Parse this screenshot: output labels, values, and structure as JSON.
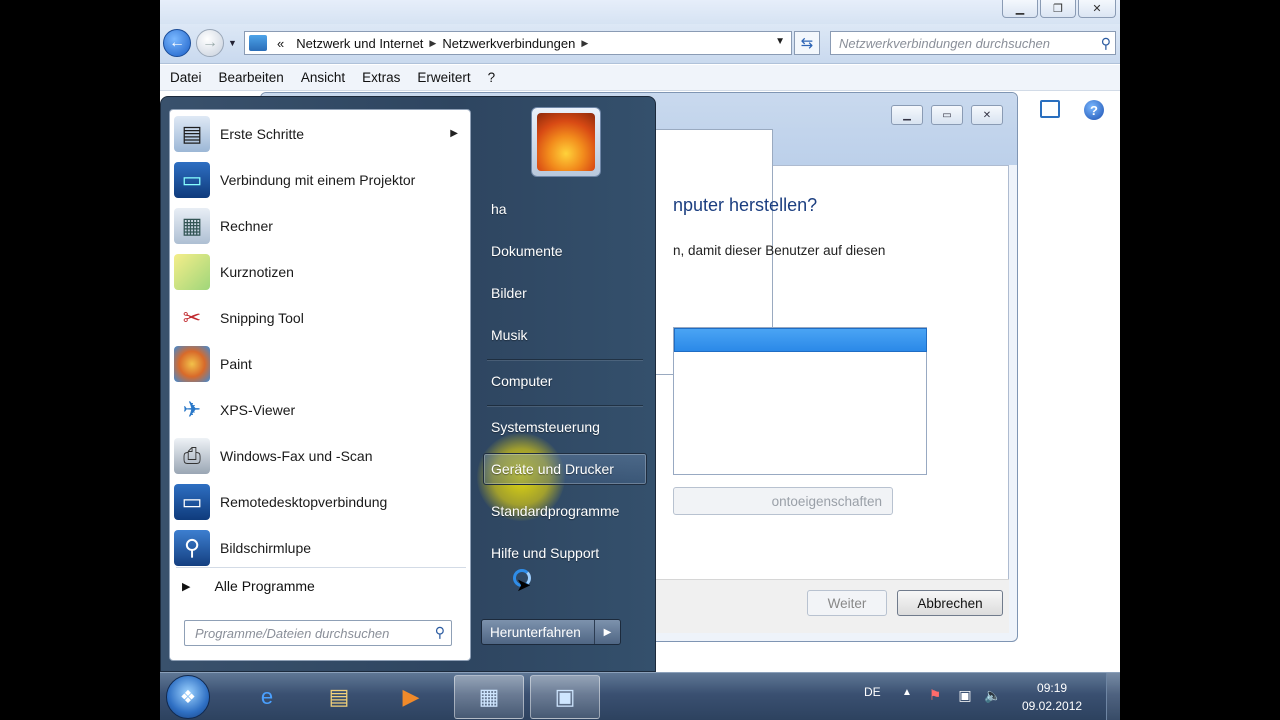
{
  "explorer": {
    "address": {
      "crumb_prefix": "«",
      "crumbs": [
        "Netzwerk und Internet",
        "Netzwerkverbindungen"
      ]
    },
    "search_placeholder": "Netzwerkverbindungen durchsuchen",
    "menu": [
      "Datei",
      "Bearbeiten",
      "Ansicht",
      "Extras",
      "Erweitert",
      "?"
    ]
  },
  "dialog": {
    "heading_fragment": "nputer herstellen?",
    "text_fragment": "n, damit dieser Benutzer auf diesen",
    "account_button_fragment": "ontoeigenschaften",
    "weiter": "Weiter",
    "abbrechen": "Abbrechen"
  },
  "start_menu": {
    "programs": [
      {
        "label": "Erste Schritte",
        "icon": "getting-started-icon",
        "has_submenu": true
      },
      {
        "label": "Verbindung mit einem Projektor",
        "icon": "projector-icon"
      },
      {
        "label": "Rechner",
        "icon": "calculator-icon"
      },
      {
        "label": "Kurznotizen",
        "icon": "sticky-notes-icon"
      },
      {
        "label": "Snipping Tool",
        "icon": "scissors-icon"
      },
      {
        "label": "Paint",
        "icon": "paint-icon"
      },
      {
        "label": "XPS-Viewer",
        "icon": "xps-viewer-icon"
      },
      {
        "label": "Windows-Fax und -Scan",
        "icon": "fax-icon"
      },
      {
        "label": "Remotedesktopverbindung",
        "icon": "remote-desktop-icon"
      },
      {
        "label": "Bildschirmlupe",
        "icon": "magnifier-icon"
      }
    ],
    "all_programs": "Alle Programme",
    "search_placeholder": "Programme/Dateien durchsuchen",
    "right_items": [
      "ha",
      "Dokumente",
      "Bilder",
      "Musik",
      "Computer",
      "Systemsteuerung",
      "Geräte und Drucker",
      "Standardprogramme",
      "Hilfe und Support"
    ],
    "shutdown": "Herunterfahren"
  },
  "taskbar": {
    "language": "DE",
    "time": "09:19",
    "date": "09.02.2012"
  }
}
